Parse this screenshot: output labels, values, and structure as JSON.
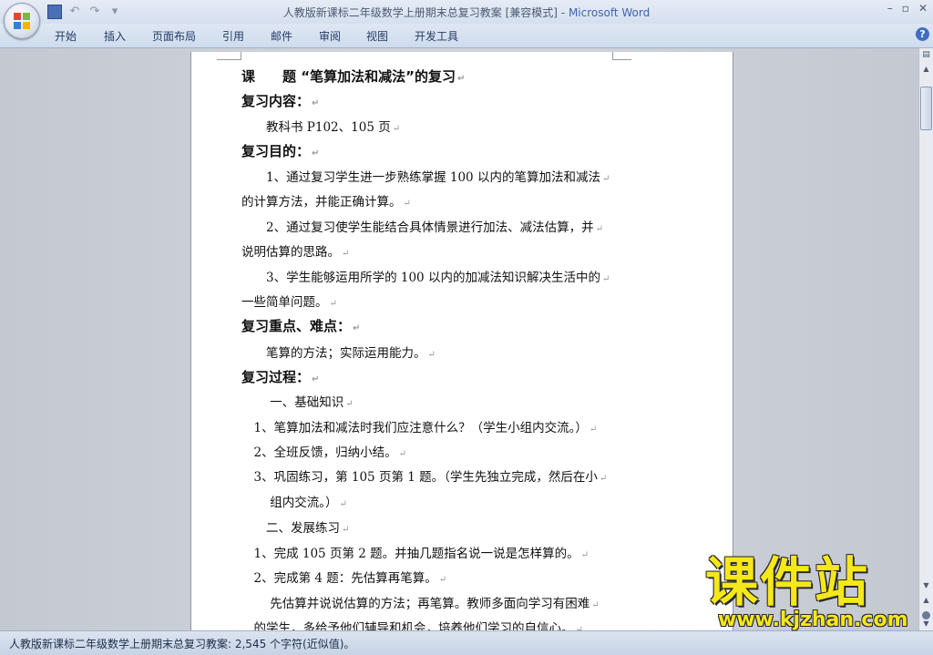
{
  "window": {
    "title": "人教版新课标二年级数学上册期末总复习教案 [兼容模式]",
    "separator": " - ",
    "app_name": "Microsoft Word",
    "controls": {
      "minimize": "–",
      "restore": "▫",
      "close": "✕"
    }
  },
  "qat": {
    "undo": "↶",
    "redo": "↷",
    "more": "▾"
  },
  "ribbon": {
    "tabs": [
      "开始",
      "插入",
      "页面布局",
      "引用",
      "邮件",
      "审阅",
      "视图",
      "开发工具"
    ],
    "help": "?"
  },
  "document": {
    "lines": [
      {
        "text": "课　　题 “笔算加法和减法”的复习",
        "style": "h"
      },
      {
        "text": "复习内容：",
        "style": "h"
      },
      {
        "text": "　　教科书 P102、105 页",
        "style": "b"
      },
      {
        "text": "复习目的：",
        "style": "h"
      },
      {
        "text": "　　1、通过复习学生进一步熟练掌握 100 以内的笔算加法和减法",
        "style": "b"
      },
      {
        "text": "的计算方法，并能正确计算。",
        "style": "b"
      },
      {
        "text": "　　2、通过复习使学生能结合具体情景进行加法、减法估算，并",
        "style": "b"
      },
      {
        "text": "说明估算的思路。",
        "style": "b"
      },
      {
        "text": "　　3、学生能够运用所学的 100 以内的加减法知识解决生活中的",
        "style": "b"
      },
      {
        "text": "一些简单问题。",
        "style": "b"
      },
      {
        "text": "复习重点、难点：",
        "style": "h"
      },
      {
        "text": "　　笔算的方法；实际运用能力。",
        "style": "b"
      },
      {
        "text": "复习过程：",
        "style": "h"
      },
      {
        "text": "　　 一、基础知识",
        "style": "b"
      },
      {
        "text": "　1、笔算加法和减法时我们应注意什么？（学生小组内交流。）",
        "style": "b"
      },
      {
        "text": "　2、全班反馈，归纳小结。",
        "style": "b"
      },
      {
        "text": "　3、巩固练习，第 105 页第 1 题。（学生先独立完成，然后在小",
        "style": "b"
      },
      {
        "text": "　　 组内交流。）",
        "style": "b"
      },
      {
        "text": "　　二、发展练习",
        "style": "b"
      },
      {
        "text": "　1、完成 105 页第 2 题。并抽几题指名说一说是怎样算的。",
        "style": "b"
      },
      {
        "text": "　2、完成第 4 题：先估算再笔算。",
        "style": "b"
      },
      {
        "text": "　　 先估算并说说估算的方法；再笔算。教师多面向学习有困难",
        "style": "b"
      },
      {
        "text": "　的学生，多给予他们辅导和机会，培养他们学习的自信心。",
        "style": "b"
      }
    ],
    "paragraph_mark": "↵"
  },
  "statusbar": {
    "text": "人教版新课标二年级数学上册期末总复习教案: 2,545 个字符(近似值)。"
  },
  "watermark": {
    "brand": "课件站",
    "url": "www.kjzhan.com"
  }
}
